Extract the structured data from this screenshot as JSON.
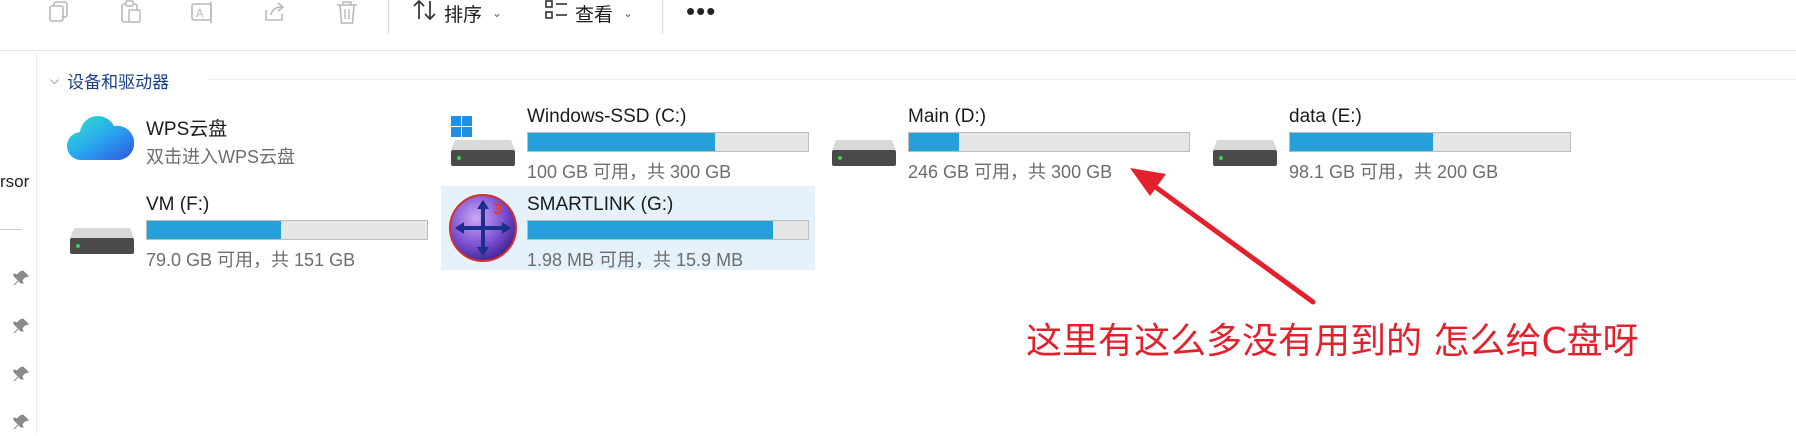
{
  "toolbar": {
    "icons": [
      "copy-icon",
      "paste-icon",
      "rename-icon",
      "share-icon",
      "delete-icon"
    ],
    "sort_label": "排序",
    "view_label": "查看",
    "more_label": "•••"
  },
  "left_pane": {
    "truncated_text": "rsor"
  },
  "group": {
    "title": "设备和驱动器"
  },
  "wps": {
    "name": "WPS云盘",
    "subtitle": "双击进入WPS云盘"
  },
  "drives": [
    {
      "name": "Windows-SSD (C:)",
      "info": "100 GB 可用，共 300 GB",
      "used_fraction": 0.667,
      "icon": "windows-drive-icon"
    },
    {
      "name": "Main (D:)",
      "info": "246 GB 可用，共 300 GB",
      "used_fraction": 0.18,
      "icon": "hard-drive-icon"
    },
    {
      "name": "data (E:)",
      "info": "98.1 GB 可用，共 200 GB",
      "used_fraction": 0.51,
      "icon": "hard-drive-icon"
    },
    {
      "name": "VM (F:)",
      "info": "79.0 GB 可用，共 151 GB",
      "used_fraction": 0.477,
      "icon": "hard-drive-icon"
    },
    {
      "name": "SMARTLINK (G:)",
      "info": "1.98 MB 可用，共 15.9 MB",
      "used_fraction": 0.875,
      "icon": "smartlink-icon"
    }
  ],
  "annotation": {
    "text": "这里有这么多没有用到的 怎么给C盘呀",
    "color": "#e3202c"
  },
  "colors": {
    "bar_fill": "#26a0da",
    "group_header": "#1a3f8c",
    "selected_bg": "#e5f1fb"
  }
}
